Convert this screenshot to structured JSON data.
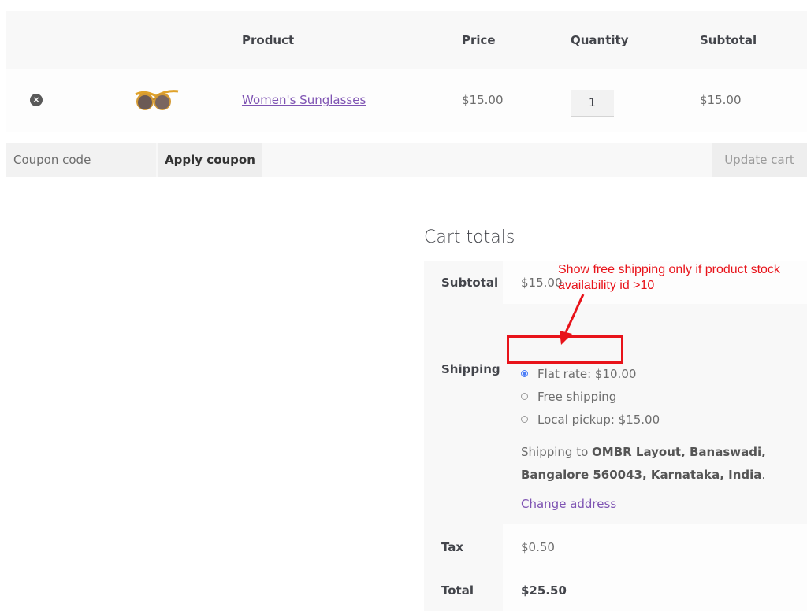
{
  "cart": {
    "headers": {
      "product": "Product",
      "price": "Price",
      "quantity": "Quantity",
      "subtotal": "Subtotal"
    },
    "items": [
      {
        "name": "Women's Sunglasses",
        "price": "$15.00",
        "quantity": "1",
        "subtotal": "$15.00",
        "remove_icon": "×"
      }
    ],
    "coupon": {
      "placeholder": "Coupon code",
      "apply_label": "Apply coupon"
    },
    "update_label": "Update cart"
  },
  "totals": {
    "title": "Cart totals",
    "subtotal_label": "Subtotal",
    "subtotal_value": "$15.00",
    "shipping_label": "Shipping",
    "shipping_options": [
      {
        "label": "Flat rate: $10.00",
        "selected": true
      },
      {
        "label": "Free shipping",
        "selected": false
      },
      {
        "label": "Local pickup: $15.00",
        "selected": false
      }
    ],
    "shipping_to_prefix": "Shipping to ",
    "shipping_address": "OMBR Layout, Banaswadi, Bangalore 560043, Karnataka, India",
    "shipping_to_suffix": ".",
    "change_address": "Change address",
    "tax_label": "Tax",
    "tax_value": "$0.50",
    "total_label": "Total",
    "total_value": "$25.50"
  },
  "annotation": {
    "text": "Show free shipping only if product stock availability id >10",
    "color": "#e8131a"
  },
  "colors": {
    "link": "#7f54b3",
    "radio_selected": "#4a7cf7"
  }
}
